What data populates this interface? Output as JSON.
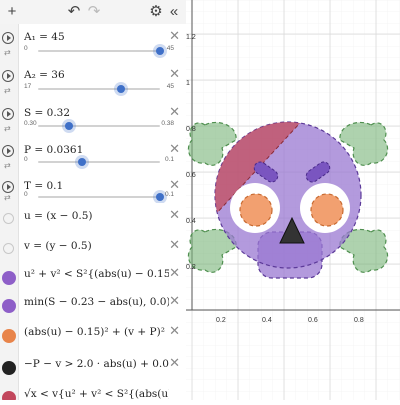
{
  "toolbar": {
    "add_icon": "plus-icon",
    "undo_icon": "undo-icon",
    "redo_icon": "redo-icon",
    "settings_icon": "gear-icon",
    "collapse_icon": "double-chevron-left-icon"
  },
  "expressions": [
    {
      "id": 1,
      "label": "A₁ = 45",
      "slider": {
        "min": "0",
        "max": "45",
        "fraction": 1.0
      }
    },
    {
      "id": 2,
      "label": "A₂ = 36",
      "slider": {
        "min": "17",
        "max": "45",
        "fraction": 0.68
      }
    },
    {
      "id": 3,
      "label": "S = 0.32",
      "slider": {
        "min": "0.30",
        "max": "0.38",
        "fraction": 0.25
      }
    },
    {
      "id": 4,
      "label": "P = 0.0361",
      "slider": {
        "min": "0",
        "max": "0.1",
        "fraction": 0.36
      }
    },
    {
      "id": 5,
      "label": "T = 0.1",
      "slider": {
        "min": "0",
        "max": "0.1",
        "fraction": 1.0
      }
    },
    {
      "id": 6,
      "label": "u = (x − 0.5)"
    },
    {
      "id": 7,
      "label": "v = (y − 0.5)"
    },
    {
      "id": 8,
      "label": "u² + v² < S²{(abs(u) − 0.15)² +",
      "color": "#8e5fc8"
    },
    {
      "id": 9,
      "label": "min(S − 0.23 − abs(u), 0.0)⁴ +₁",
      "color": "#8e5fc8"
    },
    {
      "id": 10,
      "label": "(abs(u) − 0.15)² + (v + P)² < 0",
      "color": "#e8844a"
    },
    {
      "id": 11,
      "label": "−P − v > 2.0 · abs(u) + 0.05{−P",
      "color": "#222222"
    },
    {
      "id": 12,
      "label": "√x < v{u² + v² < S²{(abs(u) −",
      "color": "#c2475c"
    }
  ],
  "graph": {
    "x_ticks": [
      "0.2",
      "0.4",
      "0.6",
      "0.8"
    ],
    "y_ticks": [
      "0.2",
      "0.4",
      "0.6",
      "0.8",
      "1",
      "1.2"
    ],
    "colors": {
      "purple": "#8e5fc8",
      "orange": "#f2a070",
      "green": "#78b478",
      "red": "#c44e5c",
      "black": "#333333"
    }
  }
}
